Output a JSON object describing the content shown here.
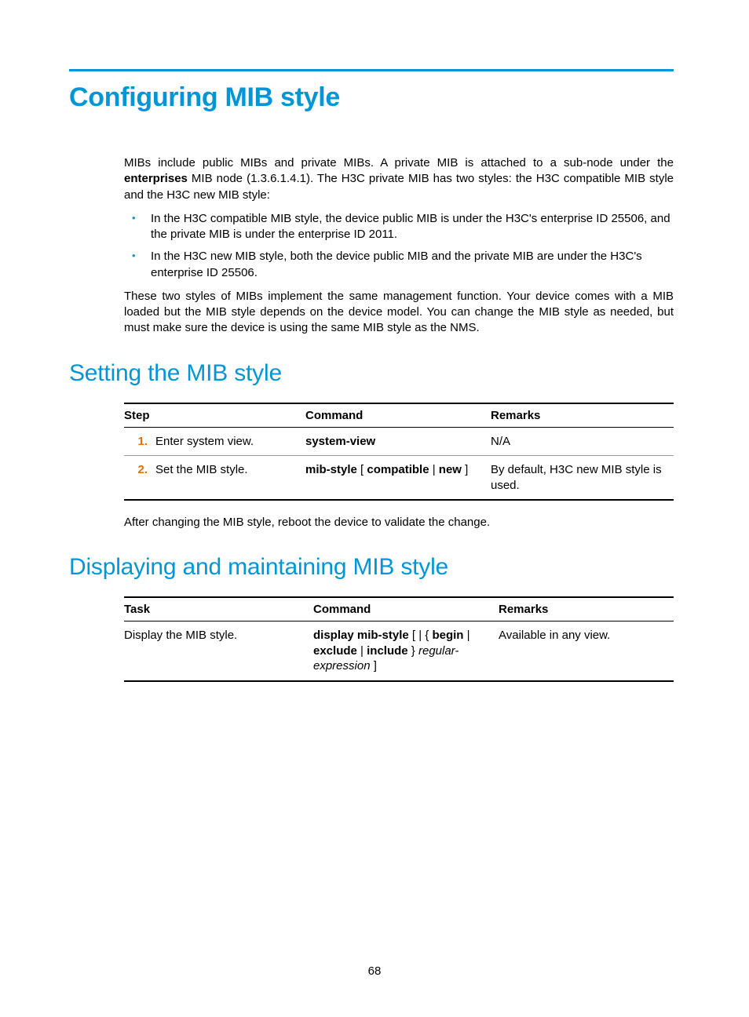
{
  "h1": "Configuring MIB style",
  "intro_para": "MIBs include public MIBs and private MIBs. A private MIB is attached to a sub-node under the ",
  "intro_bold": "enterprises",
  "intro_tail": " MIB node (1.3.6.1.4.1). The H3C private MIB has two styles: the H3C compatible MIB style and the H3C new MIB style:",
  "bullets": [
    "In the H3C compatible MIB style, the device public MIB is under the H3C's enterprise ID 25506, and the private MIB is under the enterprise ID 2011.",
    "In the H3C new MIB style, both the device public MIB and the private MIB are under the H3C's enterprise ID 25506."
  ],
  "para2": "These two styles of MIBs implement the same management function. Your device comes with a MIB loaded but the MIB style depends on the device model. You can change the MIB style as needed, but must make sure the device is using the same MIB style as the NMS.",
  "h2a": "Setting the MIB style",
  "table1": {
    "headers": {
      "step": "Step",
      "command": "Command",
      "remarks": "Remarks"
    },
    "rows": [
      {
        "num": "1.",
        "desc": "Enter system view.",
        "cmd_bold": "system-view",
        "cmd_plain": "",
        "remarks": "N/A"
      },
      {
        "num": "2.",
        "desc": "Set the MIB style.",
        "cmd_bold": "mib-style",
        "cmd_plain1": " [ ",
        "cmd_bold2": "compatible",
        "cmd_sep": " | ",
        "cmd_bold3": "new",
        "cmd_plain2": " ]",
        "remarks": "By default, H3C new MIB style is used."
      }
    ]
  },
  "after_table1": "After changing the MIB style, reboot the device to validate the change.",
  "h2b": "Displaying and maintaining MIB style",
  "table2": {
    "headers": {
      "task": "Task",
      "command": "Command",
      "remarks": "Remarks"
    },
    "rows": [
      {
        "task": "Display the MIB style.",
        "cmd_b1": "display mib-style",
        "cmd_p1": " [ | { ",
        "cmd_b2": "begin",
        "cmd_p2": " | ",
        "cmd_b3": "exclude",
        "cmd_p3": " | ",
        "cmd_b4": "include",
        "cmd_p4": " } ",
        "cmd_i1": "regular-expression",
        "cmd_p5": " ]",
        "remarks": "Available in any view."
      }
    ]
  },
  "page_num": "68"
}
